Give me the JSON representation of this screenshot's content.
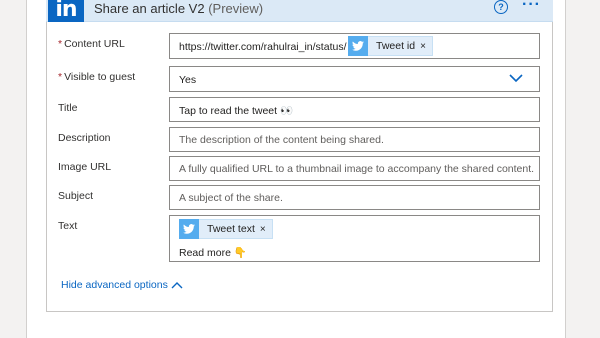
{
  "header": {
    "logo_text": "in",
    "title": "Share an article V2",
    "preview": "(Preview)",
    "help_glyph": "?",
    "more_glyph": "···",
    "accent_color": "#0a66c2"
  },
  "fields": {
    "content_url": {
      "label": "Content URL",
      "required_mark": "*",
      "value_prefix": "https://twitter.com/rahulrai_in/status/",
      "token_label": "Tweet id",
      "token_remove": "×"
    },
    "visible_to_guest": {
      "label": "Visible to guest",
      "required_mark": "*",
      "value": "Yes"
    },
    "title": {
      "label": "Title",
      "value": "Tap to read the tweet 👀"
    },
    "description": {
      "label": "Description",
      "placeholder": "The description of the content being shared."
    },
    "image_url": {
      "label": "Image URL",
      "placeholder": "A fully qualified URL to a thumbnail image to accompany the shared content."
    },
    "subject": {
      "label": "Subject",
      "placeholder": "A subject of the share."
    },
    "text": {
      "label": "Text",
      "token_label": "Tweet text",
      "token_remove": "×",
      "value_suffix": "Read more 👇"
    }
  },
  "footer": {
    "advanced_toggle": "Hide advanced options"
  },
  "icons": {
    "token_icon": "twitter-bird-icon",
    "dropdown_icon": "chevron-down-icon",
    "collapse_icon": "chevron-up-icon",
    "twitter_color": "#55acee"
  }
}
